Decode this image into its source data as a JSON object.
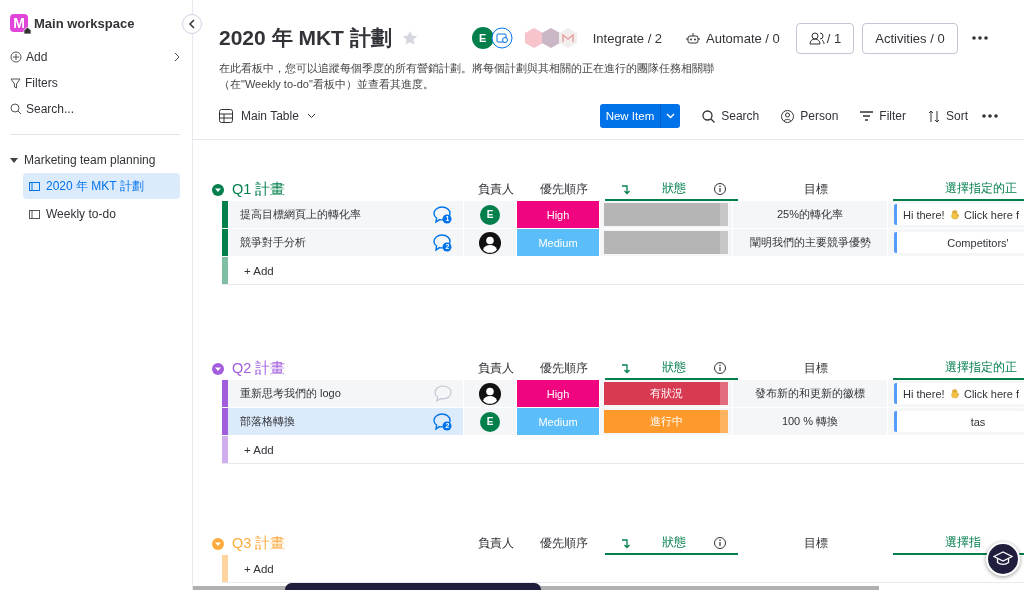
{
  "sidebar": {
    "workspace": "Main workspace",
    "logo_letter": "M",
    "actions": [
      {
        "kind": "add",
        "label": "Add"
      },
      {
        "kind": "filter",
        "label": "Filters"
      },
      {
        "kind": "search",
        "label": "Search..."
      }
    ],
    "folder": {
      "label": "Marketing team planning",
      "expanded": true,
      "children": [
        {
          "label": "2020 年 MKT 計劃",
          "selected": true
        },
        {
          "label": "Weekly to-do",
          "selected": false
        }
      ]
    }
  },
  "header": {
    "title": "2020 年 MKT 計劃",
    "avatar": "E",
    "integrate": "Integrate / 2",
    "automate": "Automate / 0",
    "members": "/ 1",
    "activities": "Activities / 0",
    "description": [
      "在此看板中，您可以追蹤每個季度的所有營銷計劃。將每個計劃與其相關的正在進行的團隊任務相關聯",
      "（在\"Weekly to-do\"看板中）並查看其進度。"
    ]
  },
  "toolbar": {
    "view": "Main Table",
    "new_item": "New Item",
    "search": "Search",
    "person": "Person",
    "filter": "Filter",
    "sort": "Sort"
  },
  "groups": [
    {
      "title": "Q1 計畫",
      "color": "#037f4c",
      "columns": [
        "負責人",
        "優先順序",
        "狀態",
        "目標",
        "選擇指定的正"
      ],
      "add": "+ Add",
      "rows": [
        {
          "name": "提高目標網頁上的轉化率",
          "updates": "1",
          "selected": false,
          "person": {
            "kind": "initial",
            "letter": "E"
          },
          "priority": {
            "label": "High",
            "color": "#f0047f"
          },
          "status": {
            "color": "#b5b5b5"
          },
          "goal": "25%的轉化率",
          "link": [
            "Hi there!",
            "Click here f"
          ]
        },
        {
          "name": "競爭對手分析",
          "updates": "2",
          "selected": false,
          "person": {
            "kind": "avatar"
          },
          "priority": {
            "label": "Medium",
            "color": "#5cbdfb"
          },
          "status": {
            "color": "#b5b5b5"
          },
          "goal": "闡明我們的主要競爭優勢",
          "link": [
            "Competitors'"
          ]
        }
      ]
    },
    {
      "title": "Q2 計畫",
      "color": "#a25ddc",
      "columns": [
        "負責人",
        "優先順序",
        "狀態",
        "目標",
        "選擇指定的正"
      ],
      "add": "+ Add",
      "rows": [
        {
          "name": "重新思考我們的 logo",
          "selected": false,
          "person": {
            "kind": "avatar"
          },
          "priority": {
            "label": "High",
            "color": "#f0047f"
          },
          "status": {
            "label": "有狀況",
            "color": "#d83a52"
          },
          "goal": "發布新的和更新的徽標",
          "link": [
            "Hi there!",
            "Click here f"
          ]
        },
        {
          "name": "部落格轉換",
          "updates": "2",
          "selected": true,
          "person": {
            "kind": "initial",
            "letter": "E"
          },
          "priority": {
            "label": "Medium",
            "color": "#5cbdfb"
          },
          "status": {
            "label": "進行中",
            "color": "#fd9a2b"
          },
          "goal": "100 % 轉換",
          "link": [
            "tas"
          ]
        }
      ]
    },
    {
      "title": "Q3 計畫",
      "color": "#fdab3d",
      "columns": [
        "負責人",
        "優先順序",
        "狀態",
        "目標",
        "選擇指"
      ],
      "add": "+ Add"
    }
  ]
}
